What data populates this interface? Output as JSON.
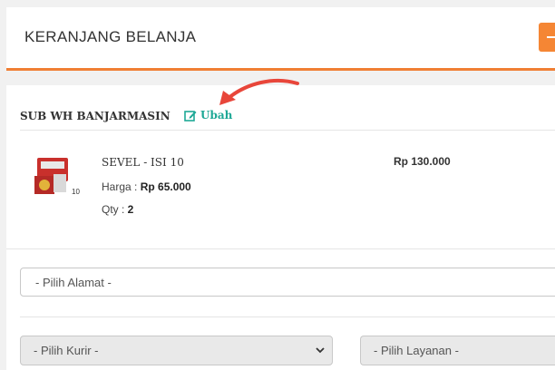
{
  "header": {
    "title": "KERANJANG BELANJA"
  },
  "store": {
    "name": "SUB WH BANJARMASIN",
    "edit_label": "Ubah"
  },
  "item": {
    "name": "SEVEL - ISI 10",
    "price_label": "Harga : ",
    "price": "Rp 65.000",
    "qty_label": "Qty : ",
    "qty": "2",
    "total": "Rp 130.000",
    "thumb_badge": "10"
  },
  "address": {
    "placeholder": "- Pilih Alamat -"
  },
  "courier": {
    "placeholder": "- Pilih Kurir -"
  },
  "service": {
    "placeholder": "- Pilih Layanan -"
  },
  "colors": {
    "accent": "#f07f34",
    "link": "#1ea896",
    "annotation_arrow": "#e8463a"
  }
}
